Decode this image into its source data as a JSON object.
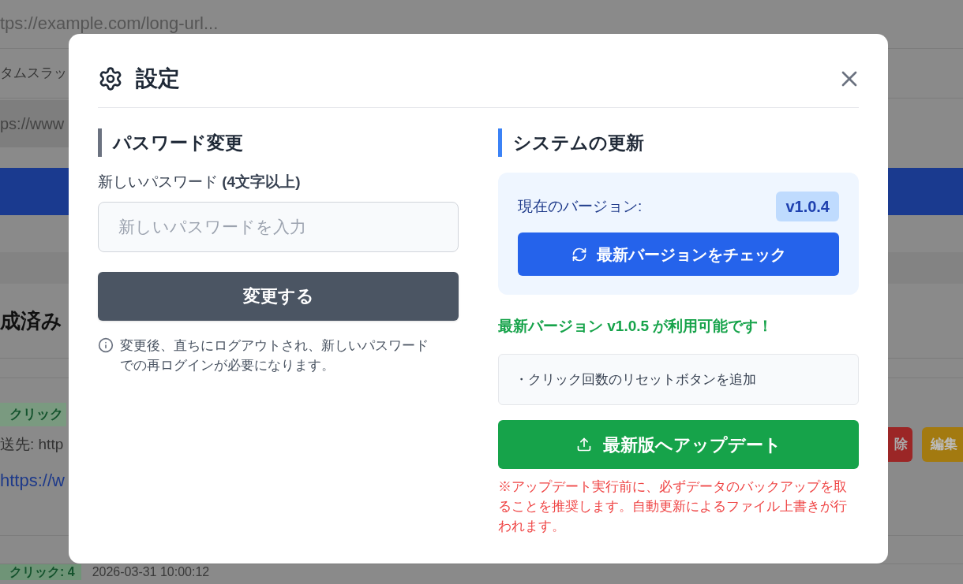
{
  "background": {
    "url_text": "tps://example.com/long-url...",
    "slug_label": "タムスラッ",
    "url_field": "ps://www",
    "section_heading": "成済み",
    "click_badge": "クリック",
    "redirect_text": "送先: http",
    "link_text": "https://w",
    "delete_button": "除",
    "edit_button": "編集",
    "bottom_click_badge": "クリック: 4",
    "bottom_date": "2026-03-31 10:00:12"
  },
  "dialog": {
    "title": "設定",
    "password": {
      "heading": "パスワード変更",
      "label": "新しいパスワード **(4文字以上)**",
      "placeholder": "新しいパスワードを入力",
      "button": "変更する",
      "note": "変更後、直ちにログアウトされ、新しいパスワードでの再ログインが必要になります。"
    },
    "update": {
      "heading": "システムの更新",
      "current_label": "現在のバージョン:",
      "current_version": "v1.0.4",
      "check_button": "最新バージョンをチェック",
      "available_message": "最新バージョン v1.0.5 が利用可能です！",
      "changelog": [
        "・クリック回数のリセットボタンを追加"
      ],
      "update_button": "最新版へアップデート",
      "warning": "※アップデート実行前に、必ずデータのバックアップを取ることを推奨します。自動更新によるファイル上書きが行われます。"
    }
  }
}
